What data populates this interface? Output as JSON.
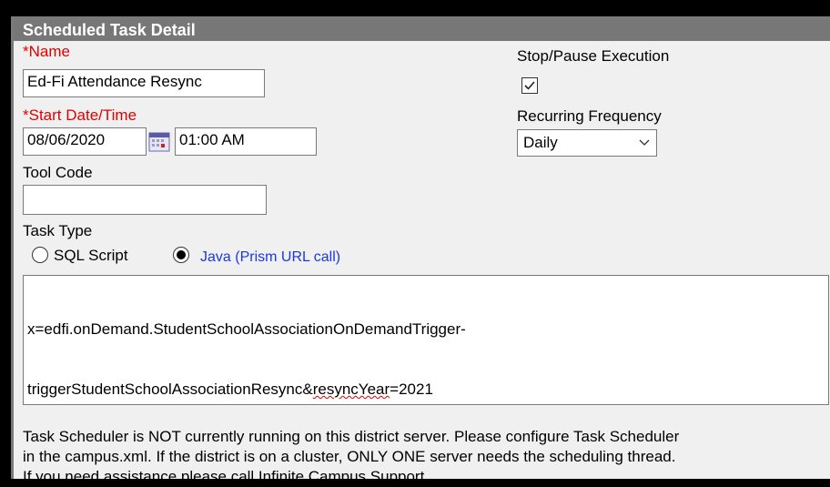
{
  "header": {
    "title": "Scheduled Task Detail"
  },
  "name_field": {
    "required_mark": "*",
    "label": "Name",
    "value": "Ed-Fi Attendance Resync"
  },
  "start_field": {
    "required_mark": "*",
    "label": "Start Date/Time",
    "date": "08/06/2020",
    "time": "01:00 AM"
  },
  "tool_code": {
    "label": "Tool Code",
    "value": ""
  },
  "task_type": {
    "label": "Task Type",
    "options": [
      "SQL Script",
      "Java (Prism URL call)"
    ],
    "selected": "Java (Prism URL call)"
  },
  "stop_pause": {
    "label": "Stop/Pause Execution",
    "checked": true
  },
  "recurring": {
    "label": "Recurring Frequency",
    "value": "Daily"
  },
  "script_text": {
    "line1": "x=edfi.onDemand.StudentSchoolAssociationOnDemandTrigger-",
    "line2_before": "triggerStudentSchoolAssociationResync&",
    "line2_underlined": "resyncYear",
    "line2_after": "=2021"
  },
  "notice": {
    "line1": "Task Scheduler is NOT currently running on this district server. Please configure Task Scheduler",
    "line2": "in the campus.xml. If the district is on a cluster, ONLY ONE server needs the scheduling thread.",
    "line3": "If you need assistance please call Infinite Campus Support."
  },
  "colors": {
    "required": "#e00000",
    "java_label": "#1a37e8",
    "header_bg": "#777777"
  },
  "icons": {
    "calendar": "calendar-icon",
    "check": "checkmark-icon",
    "dropdown": "chevron-down-icon"
  }
}
